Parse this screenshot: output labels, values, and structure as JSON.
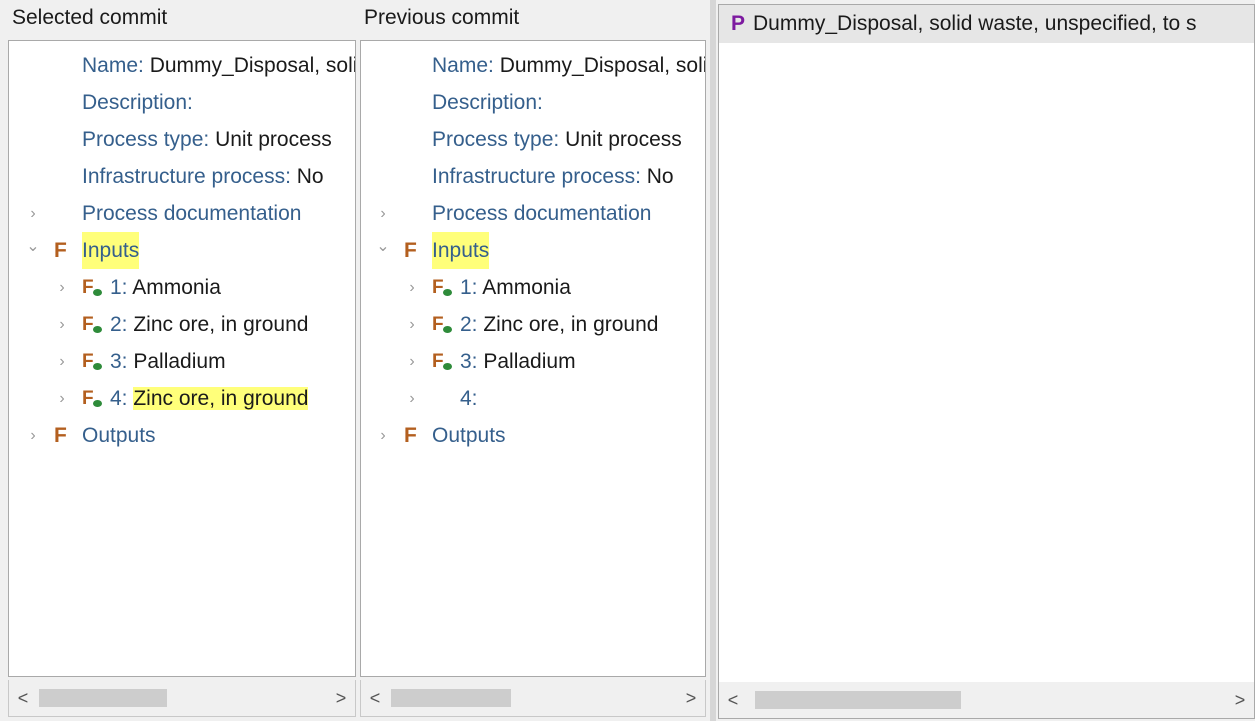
{
  "left": {
    "header": "Selected commit",
    "rows": {
      "name_label": "Name:",
      "name_value": "Dummy_Disposal, solid waste, unspecified",
      "desc_label": "Description:",
      "ptype_label": "Process type:",
      "ptype_value": "Unit process",
      "infra_label": "Infrastructure process:",
      "infra_value": "No",
      "doc_label": "Process documentation",
      "inputs_label": "Inputs",
      "in1_num": "1:",
      "in1_val": "Ammonia",
      "in2_num": "2:",
      "in2_val": "Zinc ore, in ground",
      "in3_num": "3:",
      "in3_val": "Palladium",
      "in4_num": "4:",
      "in4_val": "Zinc ore, in ground",
      "outputs_label": "Outputs"
    }
  },
  "middle": {
    "header": "Previous commit",
    "rows": {
      "name_label": "Name:",
      "name_value": "Dummy_Disposal, solid waste, unspecified",
      "desc_label": "Description:",
      "ptype_label": "Process type:",
      "ptype_value": "Unit process",
      "infra_label": "Infrastructure process:",
      "infra_value": "No",
      "doc_label": "Process documentation",
      "inputs_label": "Inputs",
      "in1_num": "1:",
      "in1_val": "Ammonia",
      "in2_num": "2:",
      "in2_val": "Zinc ore, in ground",
      "in3_num": "3:",
      "in3_val": "Palladium",
      "in4_num": "4:",
      "outputs_label": "Outputs"
    }
  },
  "right": {
    "icon": "P",
    "title": "Dummy_Disposal, solid waste, unspecified, to s"
  },
  "glyphs": {
    "collapsed": "›",
    "expanded": "⌄",
    "scroll_left": "<",
    "scroll_right": ">",
    "flow_icon": "F"
  },
  "colors": {
    "highlight": "#ffff7a",
    "label": "#355f8c",
    "flow_icon": "#b35f1f",
    "process_icon": "#7d1aa0"
  }
}
